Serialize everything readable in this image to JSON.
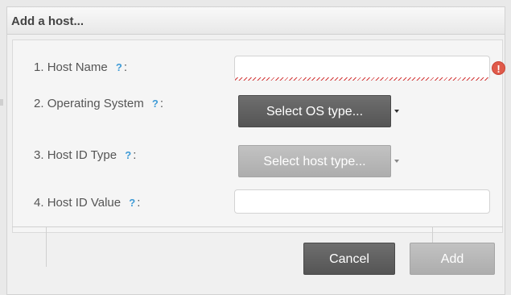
{
  "dialog": {
    "title": "Add a host..."
  },
  "form": {
    "host_name": {
      "number": "1.",
      "label": "Host Name",
      "help": "?",
      "colon": ":",
      "value": "",
      "error_icon": "!"
    },
    "operating_system": {
      "number": "2.",
      "label": "Operating System",
      "help": "?",
      "colon": ":",
      "button_label": "Select OS type..."
    },
    "host_id_type": {
      "number": "3.",
      "label": "Host ID Type",
      "help": "?",
      "colon": ":",
      "button_label": "Select host type..."
    },
    "host_id_value": {
      "number": "4.",
      "label": "Host ID Value",
      "help": "?",
      "colon": ":",
      "value": ""
    }
  },
  "actions": {
    "cancel_label": "Cancel",
    "add_label": "Add"
  },
  "colors": {
    "help_accent": "#3f9bd6",
    "error": "#e05a4a",
    "button_dark": "#5f5f5f",
    "button_disabled": "#b5b5b5"
  },
  "icons": {
    "error": "exclamation-circle-icon",
    "dropdown": "caret-down-icon",
    "help": "question-mark-icon"
  }
}
